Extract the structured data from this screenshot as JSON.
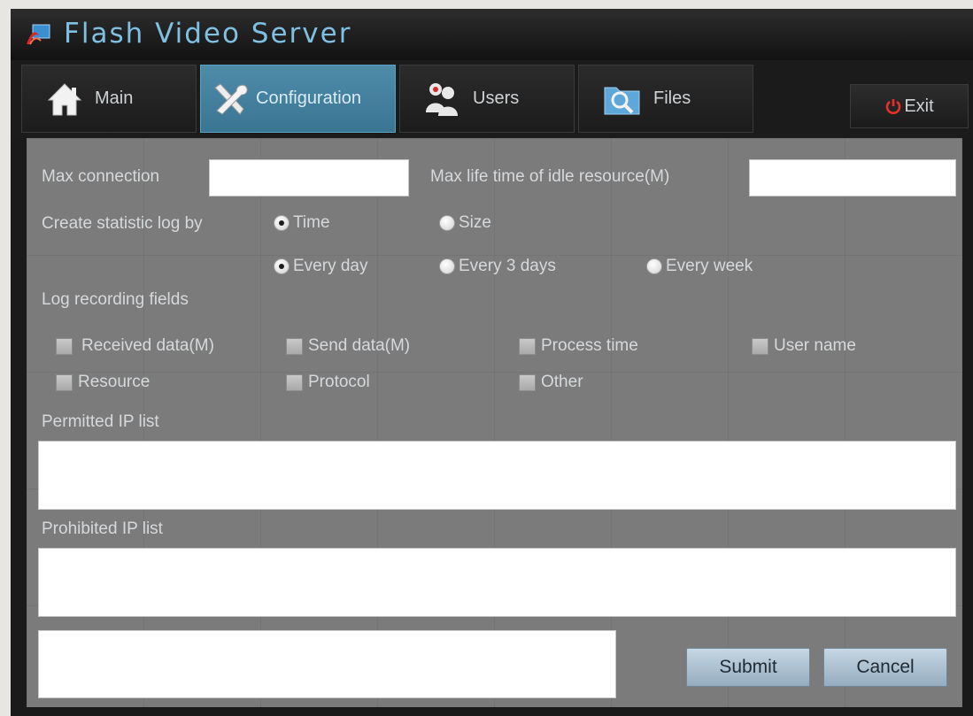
{
  "app": {
    "title": "Flash Video Server",
    "logo_icon": "flash-logo-icon",
    "accent_color": "#7fc0e2"
  },
  "tabs": [
    {
      "id": "main",
      "label": "Main",
      "icon": "home-icon",
      "active": false
    },
    {
      "id": "configuration",
      "label": "Configuration",
      "icon": "tools-icon",
      "active": true
    },
    {
      "id": "users",
      "label": "Users",
      "icon": "users-icon",
      "active": false
    },
    {
      "id": "files",
      "label": "Files",
      "icon": "files-icon",
      "active": false
    }
  ],
  "exit": {
    "label": "Exit",
    "icon": "power-icon"
  },
  "config": {
    "max_connection": {
      "label": "Max connection",
      "value": ""
    },
    "max_idle_time": {
      "label": "Max life time of idle resource(M)",
      "value": ""
    },
    "statistic_log": {
      "label": "Create statistic log by",
      "by_options": [
        {
          "label": "Time",
          "checked": true
        },
        {
          "label": "Size",
          "checked": false
        }
      ],
      "period_options": [
        {
          "label": "Every day",
          "checked": true
        },
        {
          "label": "Every 3 days",
          "checked": false
        },
        {
          "label": "Every week",
          "checked": false
        }
      ]
    },
    "log_fields": {
      "label": "Log recording fields",
      "items": [
        {
          "label": "Received  data(M)",
          "checked": false
        },
        {
          "label": "Send data(M)",
          "checked": false
        },
        {
          "label": "Process time",
          "checked": false
        },
        {
          "label": "User name",
          "checked": false
        },
        {
          "label": "Resource",
          "checked": false
        },
        {
          "label": "Protocol",
          "checked": false
        },
        {
          "label": "Other",
          "checked": false
        }
      ]
    },
    "permitted_ip": {
      "label": "Permitted IP list",
      "value": ""
    },
    "prohibited_ip": {
      "label": "Prohibited IP list",
      "value": ""
    },
    "message": {
      "value": ""
    },
    "submit_label": "Submit",
    "cancel_label": "Cancel"
  }
}
